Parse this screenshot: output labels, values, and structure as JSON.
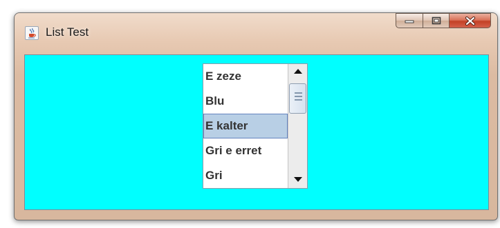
{
  "window": {
    "title": "List Test",
    "icon": "java-cup-icon",
    "controls": [
      "minimize-icon",
      "maximize-icon",
      "close-icon"
    ],
    "content_background": "#00ffff"
  },
  "list": {
    "items": [
      {
        "label": "E zeze",
        "selected": false
      },
      {
        "label": "Blu",
        "selected": false
      },
      {
        "label": "E kalter",
        "selected": true
      },
      {
        "label": "Gri e erret",
        "selected": false
      },
      {
        "label": "Gri",
        "selected": false
      }
    ],
    "selection_color": "#b8cfe5",
    "scrollbar": {
      "up_icon": "arrow-up-icon",
      "down_icon": "arrow-down-icon"
    }
  }
}
